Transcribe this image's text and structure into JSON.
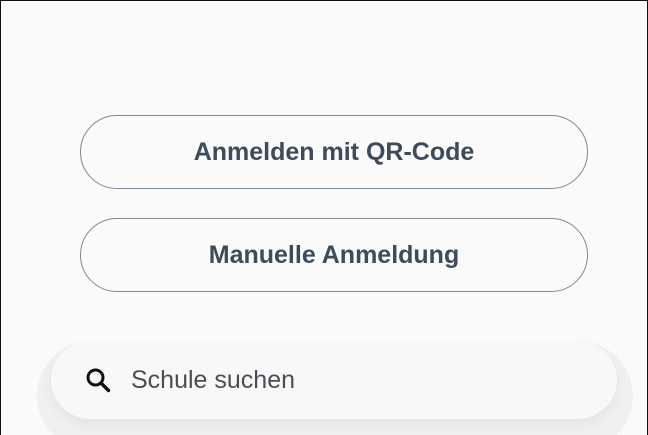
{
  "login": {
    "qr_button_label": "Anmelden mit QR-Code",
    "manual_button_label": "Manuelle Anmeldung"
  },
  "search": {
    "placeholder": "Schule suchen",
    "icon": "search-icon"
  }
}
